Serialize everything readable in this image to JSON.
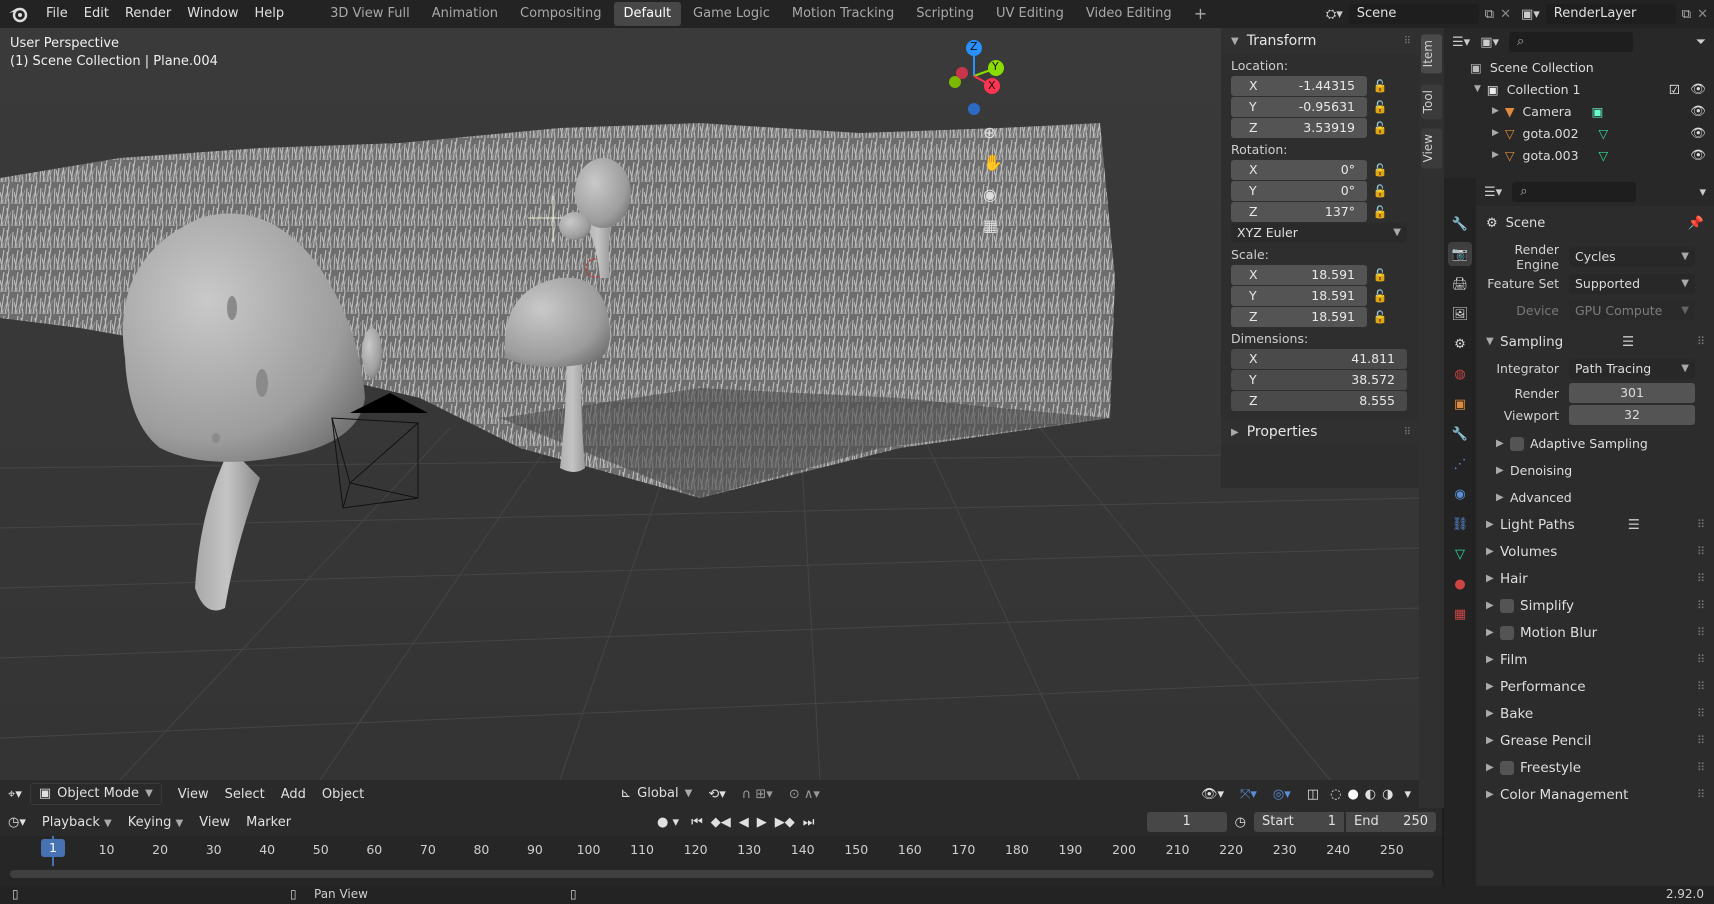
{
  "menu": [
    "File",
    "Edit",
    "Render",
    "Window",
    "Help"
  ],
  "workspaces": [
    "3D View Full",
    "Animation",
    "Compositing",
    "Default",
    "Game Logic",
    "Motion Tracking",
    "Scripting",
    "UV Editing",
    "Video Editing"
  ],
  "active_workspace": "Default",
  "scene_name": "Scene",
  "view_layer": "RenderLayer",
  "viewport": {
    "perspective": "User Perspective",
    "collection_info": "(1) Scene Collection | Plane.004",
    "gizmo_axes": [
      "Z",
      "Y",
      "X"
    ]
  },
  "npanel_tabs": [
    "Item",
    "Tool",
    "View"
  ],
  "transform": {
    "title": "Transform",
    "location_label": "Location:",
    "location": [
      {
        "axis": "X",
        "value": "-1.44315"
      },
      {
        "axis": "Y",
        "value": "-0.95631"
      },
      {
        "axis": "Z",
        "value": "3.53919"
      }
    ],
    "rotation_label": "Rotation:",
    "rotation": [
      {
        "axis": "X",
        "value": "0°"
      },
      {
        "axis": "Y",
        "value": "0°"
      },
      {
        "axis": "Z",
        "value": "137°"
      }
    ],
    "rotation_mode": "XYZ Euler",
    "scale_label": "Scale:",
    "scale": [
      {
        "axis": "X",
        "value": "18.591"
      },
      {
        "axis": "Y",
        "value": "18.591"
      },
      {
        "axis": "Z",
        "value": "18.591"
      }
    ],
    "dimensions_label": "Dimensions:",
    "dimensions": [
      {
        "axis": "X",
        "value": "41.811"
      },
      {
        "axis": "Y",
        "value": "38.572"
      },
      {
        "axis": "Z",
        "value": "8.555"
      }
    ],
    "properties_label": "Properties"
  },
  "viewport_header": {
    "mode": "Object Mode",
    "menus": [
      "View",
      "Select",
      "Add",
      "Object"
    ],
    "orientation": "Global"
  },
  "timeline": {
    "menus": [
      "Playback",
      "Keying",
      "View",
      "Marker"
    ],
    "current_frame": "1",
    "start_label": "Start",
    "start": "1",
    "end_label": "End",
    "end": "250",
    "ticks": [
      "1",
      "10",
      "20",
      "30",
      "40",
      "50",
      "60",
      "70",
      "80",
      "90",
      "100",
      "110",
      "120",
      "130",
      "140",
      "150",
      "160",
      "170",
      "180",
      "190",
      "200",
      "210",
      "220",
      "230",
      "240",
      "250"
    ]
  },
  "outliner": {
    "root": "Scene Collection",
    "collection": "Collection 1",
    "items": [
      "Camera",
      "gota.002",
      "gota.003"
    ]
  },
  "properties": {
    "context": "Scene",
    "render_engine_label": "Render Engine",
    "render_engine": "Cycles",
    "feature_set_label": "Feature Set",
    "feature_set": "Supported",
    "device_label": "Device",
    "device": "GPU Compute",
    "sampling": "Sampling",
    "integrator_label": "Integrator",
    "integrator": "Path Tracing",
    "render_label": "Render",
    "render_samples": "301",
    "viewport_label": "Viewport",
    "viewport_samples": "32",
    "sub_sections": [
      "Adaptive Sampling",
      "Denoising",
      "Advanced"
    ],
    "sections": [
      {
        "name": "Light Paths",
        "checkbox": false,
        "list": true
      },
      {
        "name": "Volumes",
        "checkbox": false
      },
      {
        "name": "Hair",
        "checkbox": false
      },
      {
        "name": "Simplify",
        "checkbox": true
      },
      {
        "name": "Motion Blur",
        "checkbox": true
      },
      {
        "name": "Film",
        "checkbox": false
      },
      {
        "name": "Performance",
        "checkbox": false
      },
      {
        "name": "Bake",
        "checkbox": false
      },
      {
        "name": "Grease Pencil",
        "checkbox": false
      },
      {
        "name": "Freestyle",
        "checkbox": true
      },
      {
        "name": "Color Management",
        "checkbox": false
      }
    ]
  },
  "status": {
    "action": "Pan View",
    "version": "2.92.0"
  },
  "colors": {
    "accent": "#4772b3",
    "x_axis": "#ff3352",
    "y_axis": "#8bdc00",
    "z_axis": "#2890ff"
  }
}
